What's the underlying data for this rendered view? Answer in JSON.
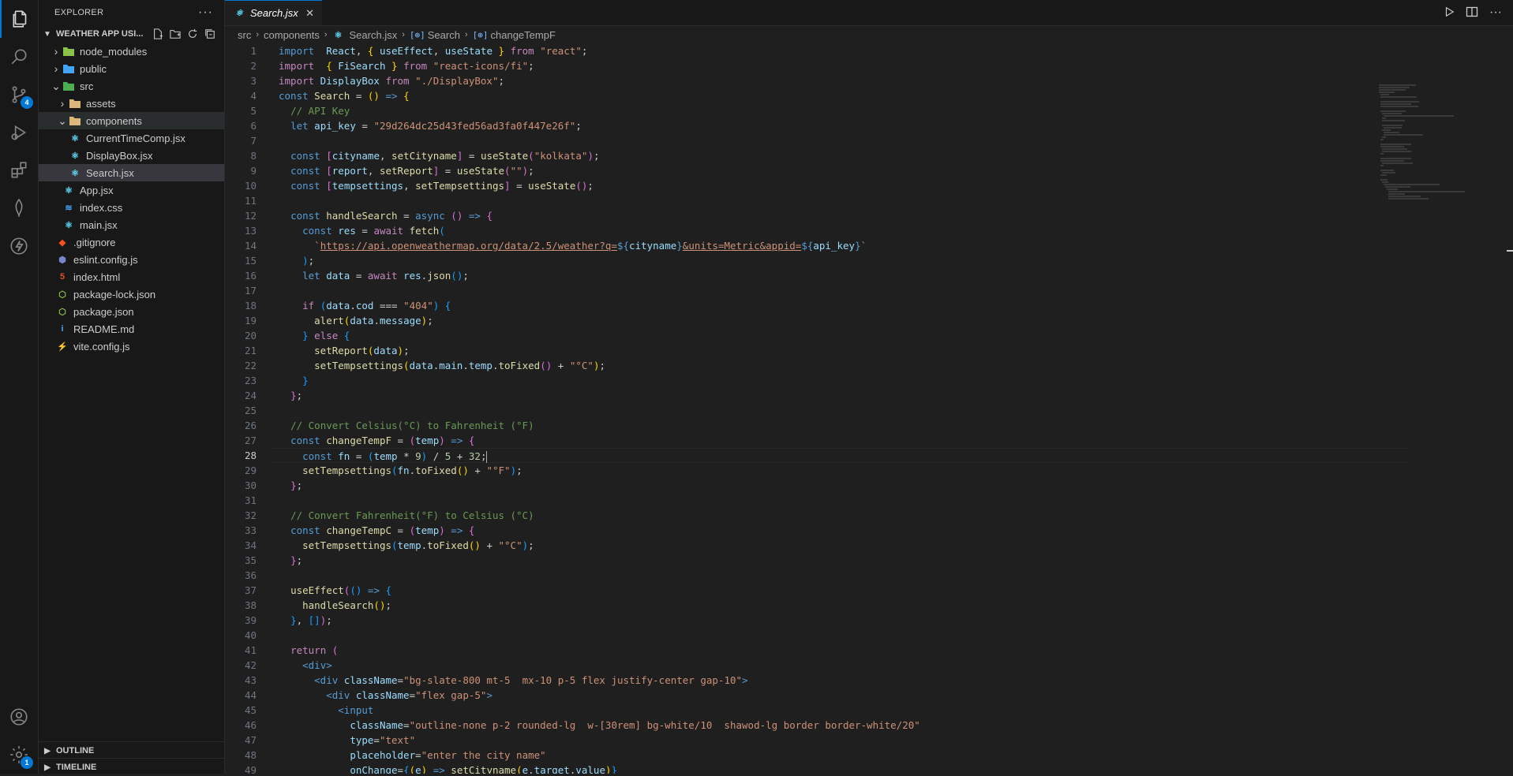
{
  "explorer": {
    "title": "EXPLORER",
    "more": "···",
    "folder": "WEATHER APP USI...",
    "items": [
      {
        "label": "node_modules",
        "indent": 1,
        "type": "folder",
        "open": false
      },
      {
        "label": "public",
        "indent": 1,
        "type": "folder",
        "open": false
      },
      {
        "label": "src",
        "indent": 1,
        "type": "folder",
        "open": true
      },
      {
        "label": "assets",
        "indent": 2,
        "type": "folder",
        "open": false
      },
      {
        "label": "components",
        "indent": 2,
        "type": "folder",
        "open": true
      },
      {
        "label": "CurrentTimeComp.jsx",
        "indent": 3,
        "type": "react"
      },
      {
        "label": "DisplayBox.jsx",
        "indent": 3,
        "type": "react"
      },
      {
        "label": "Search.jsx",
        "indent": 3,
        "type": "react"
      },
      {
        "label": "App.jsx",
        "indent": 2,
        "type": "react"
      },
      {
        "label": "index.css",
        "indent": 2,
        "type": "css"
      },
      {
        "label": "main.jsx",
        "indent": 2,
        "type": "react"
      },
      {
        "label": ".gitignore",
        "indent": 1,
        "type": "git"
      },
      {
        "label": "eslint.config.js",
        "indent": 1,
        "type": "eslint"
      },
      {
        "label": "index.html",
        "indent": 1,
        "type": "html"
      },
      {
        "label": "package-lock.json",
        "indent": 1,
        "type": "node"
      },
      {
        "label": "package.json",
        "indent": 1,
        "type": "node"
      },
      {
        "label": "README.md",
        "indent": 1,
        "type": "info"
      },
      {
        "label": "vite.config.js",
        "indent": 1,
        "type": "vite"
      }
    ],
    "outline": "OUTLINE",
    "timeline": "TIMELINE"
  },
  "activity": {
    "scm_badge": "4",
    "accounts_badge": "1"
  },
  "tab": {
    "label": "Search.jsx",
    "close": "✕"
  },
  "breadcrumb": {
    "parts": [
      "src",
      "components",
      "Search.jsx",
      "Search",
      "changeTempF"
    ],
    "sym_icon": "[⊕]"
  },
  "editor": {
    "current_line": 28,
    "lines": [
      [
        [
          "k",
          "import"
        ],
        [
          "",
          "  "
        ],
        [
          "v",
          "React"
        ],
        [
          "",
          ", "
        ],
        [
          "p1",
          "{"
        ],
        [
          "",
          ""
        ],
        [
          "v",
          " useEffect"
        ],
        [
          "",
          ", "
        ],
        [
          "v",
          "useState"
        ],
        [
          "",
          ""
        ],
        [
          "p1",
          " }"
        ],
        [
          "kc",
          " from"
        ],
        [
          "s",
          " \"react\""
        ],
        [
          "",
          ";"
        ]
      ],
      [
        [
          "kc",
          "import"
        ],
        [
          "",
          "  "
        ],
        [
          "p1",
          "{"
        ],
        [
          "v",
          " FiSearch"
        ],
        [
          "p1",
          " }"
        ],
        [
          "kc",
          " from"
        ],
        [
          "s",
          " \"react-icons/fi\""
        ],
        [
          "",
          ";"
        ]
      ],
      [
        [
          "kc",
          "import"
        ],
        [
          "v",
          " DisplayBox"
        ],
        [
          "kc",
          " from"
        ],
        [
          "s",
          " \"./DisplayBox\""
        ],
        [
          "",
          ";"
        ]
      ],
      [
        [
          "k",
          "const"
        ],
        [
          "f",
          " Search"
        ],
        [
          "",
          " = "
        ],
        [
          "p1",
          "()"
        ],
        [
          "k",
          " =>"
        ],
        [
          "p1",
          " {"
        ]
      ],
      [
        [
          "",
          "  "
        ],
        [
          "c",
          "// API Key"
        ]
      ],
      [
        [
          "",
          "  "
        ],
        [
          "k",
          "let"
        ],
        [
          "v",
          " api_key"
        ],
        [
          "",
          " = "
        ],
        [
          "s",
          "\"29d264dc25d43fed56ad3fa0f447e26f\""
        ],
        [
          "",
          ";"
        ]
      ],
      [
        [
          "",
          ""
        ]
      ],
      [
        [
          "",
          "  "
        ],
        [
          "k",
          "const"
        ],
        [
          "p2",
          " ["
        ],
        [
          "v",
          "cityname"
        ],
        [
          "",
          ", "
        ],
        [
          "f",
          "setCityname"
        ],
        [
          "p2",
          "]"
        ],
        [
          "",
          " = "
        ],
        [
          "f",
          "useState"
        ],
        [
          "p2",
          "("
        ],
        [
          "s",
          "\"kolkata\""
        ],
        [
          "p2",
          ")"
        ],
        [
          "",
          ";"
        ]
      ],
      [
        [
          "",
          "  "
        ],
        [
          "k",
          "const"
        ],
        [
          "p2",
          " ["
        ],
        [
          "v",
          "report"
        ],
        [
          "",
          ", "
        ],
        [
          "f",
          "setReport"
        ],
        [
          "p2",
          "]"
        ],
        [
          "",
          " = "
        ],
        [
          "f",
          "useState"
        ],
        [
          "p2",
          "("
        ],
        [
          "s",
          "\"\""
        ],
        [
          "p2",
          ")"
        ],
        [
          "",
          ";"
        ]
      ],
      [
        [
          "",
          "  "
        ],
        [
          "k",
          "const"
        ],
        [
          "p2",
          " ["
        ],
        [
          "v",
          "tempsettings"
        ],
        [
          "",
          ", "
        ],
        [
          "f",
          "setTempsettings"
        ],
        [
          "p2",
          "]"
        ],
        [
          "",
          " = "
        ],
        [
          "f",
          "useState"
        ],
        [
          "p2",
          "()"
        ],
        [
          "",
          ";"
        ]
      ],
      [
        [
          "",
          ""
        ]
      ],
      [
        [
          "",
          "  "
        ],
        [
          "k",
          "const"
        ],
        [
          "f",
          " handleSearch"
        ],
        [
          "",
          " = "
        ],
        [
          "k",
          "async"
        ],
        [
          "p2",
          " ()"
        ],
        [
          "k",
          " =>"
        ],
        [
          "p2",
          " {"
        ]
      ],
      [
        [
          "",
          "    "
        ],
        [
          "k",
          "const"
        ],
        [
          "v",
          " res"
        ],
        [
          "",
          " = "
        ],
        [
          "kc",
          "await"
        ],
        [
          "f",
          " fetch"
        ],
        [
          "p3",
          "("
        ]
      ],
      [
        [
          "",
          "      "
        ],
        [
          "s",
          "`"
        ],
        [
          "s u",
          "https://api.openweathermap.org/data/2.5/weather?q="
        ],
        [
          "k",
          "${"
        ],
        [
          "v",
          "cityname"
        ],
        [
          "k",
          "}"
        ],
        [
          "s u",
          "&units=Metric&appid="
        ],
        [
          "k",
          "${"
        ],
        [
          "v",
          "api_key"
        ],
        [
          "k",
          "}"
        ],
        [
          "s",
          "`"
        ]
      ],
      [
        [
          "",
          "    "
        ],
        [
          "p3",
          ")"
        ],
        [
          "",
          ";"
        ]
      ],
      [
        [
          "",
          "    "
        ],
        [
          "k",
          "let"
        ],
        [
          "v",
          " data"
        ],
        [
          "",
          " = "
        ],
        [
          "kc",
          "await"
        ],
        [
          "v",
          " res"
        ],
        [
          "",
          "."
        ],
        [
          "f",
          "json"
        ],
        [
          "p3",
          "()"
        ],
        [
          "",
          ";"
        ]
      ],
      [
        [
          "",
          ""
        ]
      ],
      [
        [
          "",
          "    "
        ],
        [
          "kc",
          "if"
        ],
        [
          "p3",
          " ("
        ],
        [
          "v",
          "data"
        ],
        [
          "",
          "."
        ],
        [
          "v",
          "cod"
        ],
        [
          "",
          " === "
        ],
        [
          "s",
          "\"404\""
        ],
        [
          "p3",
          ")"
        ],
        [
          "p3",
          " {"
        ]
      ],
      [
        [
          "",
          "      "
        ],
        [
          "f",
          "alert"
        ],
        [
          "p1",
          "("
        ],
        [
          "v",
          "data"
        ],
        [
          "",
          "."
        ],
        [
          "v",
          "message"
        ],
        [
          "p1",
          ")"
        ],
        [
          "",
          ";"
        ]
      ],
      [
        [
          "",
          "    "
        ],
        [
          "p3",
          "}"
        ],
        [
          "kc",
          " else"
        ],
        [
          "p3",
          " {"
        ]
      ],
      [
        [
          "",
          "      "
        ],
        [
          "f",
          "setReport"
        ],
        [
          "p1",
          "("
        ],
        [
          "v",
          "data"
        ],
        [
          "p1",
          ")"
        ],
        [
          "",
          ";"
        ]
      ],
      [
        [
          "",
          "      "
        ],
        [
          "f",
          "setTempsettings"
        ],
        [
          "p1",
          "("
        ],
        [
          "v",
          "data"
        ],
        [
          "",
          "."
        ],
        [
          "v",
          "main"
        ],
        [
          "",
          "."
        ],
        [
          "v",
          "temp"
        ],
        [
          "",
          "."
        ],
        [
          "f",
          "toFixed"
        ],
        [
          "p2",
          "()"
        ],
        [
          "",
          " + "
        ],
        [
          "s",
          "\"°C\""
        ],
        [
          "p1",
          ")"
        ],
        [
          "",
          ";"
        ]
      ],
      [
        [
          "",
          "    "
        ],
        [
          "p3",
          "}"
        ]
      ],
      [
        [
          "",
          "  "
        ],
        [
          "p2",
          "}"
        ],
        [
          "",
          ";"
        ]
      ],
      [
        [
          "",
          ""
        ]
      ],
      [
        [
          "",
          "  "
        ],
        [
          "c",
          "// Convert Celsius(°C) to Fahrenheit (°F)"
        ]
      ],
      [
        [
          "",
          "  "
        ],
        [
          "k",
          "const"
        ],
        [
          "f",
          " changeTempF"
        ],
        [
          "",
          " = "
        ],
        [
          "p2",
          "("
        ],
        [
          "v",
          "temp"
        ],
        [
          "p2",
          ")"
        ],
        [
          "k",
          " =>"
        ],
        [
          "p2",
          " {"
        ]
      ],
      [
        [
          "",
          "    "
        ],
        [
          "k",
          "const"
        ],
        [
          "v",
          " fn"
        ],
        [
          "",
          " = "
        ],
        [
          "p3",
          "("
        ],
        [
          "v",
          "temp"
        ],
        [
          "",
          " * "
        ],
        [
          "n",
          "9"
        ],
        [
          "p3",
          ")"
        ],
        [
          "",
          " / "
        ],
        [
          "n",
          "5"
        ],
        [
          "",
          " + "
        ],
        [
          "n",
          "32"
        ],
        [
          "",
          ";"
        ]
      ],
      [
        [
          "",
          "    "
        ],
        [
          "f",
          "setTempsettings"
        ],
        [
          "p3",
          "("
        ],
        [
          "v",
          "fn"
        ],
        [
          "",
          "."
        ],
        [
          "f",
          "toFixed"
        ],
        [
          "p1",
          "()"
        ],
        [
          "",
          " + "
        ],
        [
          "s",
          "\"°F\""
        ],
        [
          "p3",
          ")"
        ],
        [
          "",
          ";"
        ]
      ],
      [
        [
          "",
          "  "
        ],
        [
          "p2",
          "}"
        ],
        [
          "",
          ";"
        ]
      ],
      [
        [
          "",
          ""
        ]
      ],
      [
        [
          "",
          "  "
        ],
        [
          "c",
          "// Convert Fahrenheit(°F) to Celsius (°C)"
        ]
      ],
      [
        [
          "",
          "  "
        ],
        [
          "k",
          "const"
        ],
        [
          "f",
          " changeTempC"
        ],
        [
          "",
          " = "
        ],
        [
          "p2",
          "("
        ],
        [
          "v",
          "temp"
        ],
        [
          "p2",
          ")"
        ],
        [
          "k",
          " =>"
        ],
        [
          "p2",
          " {"
        ]
      ],
      [
        [
          "",
          "    "
        ],
        [
          "f",
          "setTempsettings"
        ],
        [
          "p3",
          "("
        ],
        [
          "v",
          "temp"
        ],
        [
          "",
          "."
        ],
        [
          "f",
          "toFixed"
        ],
        [
          "p1",
          "()"
        ],
        [
          "",
          " + "
        ],
        [
          "s",
          "\"°C\""
        ],
        [
          "p3",
          ")"
        ],
        [
          "",
          ";"
        ]
      ],
      [
        [
          "",
          "  "
        ],
        [
          "p2",
          "}"
        ],
        [
          "",
          ";"
        ]
      ],
      [
        [
          "",
          ""
        ]
      ],
      [
        [
          "",
          "  "
        ],
        [
          "f",
          "useEffect"
        ],
        [
          "p2",
          "("
        ],
        [
          "p3",
          "()"
        ],
        [
          "k",
          " =>"
        ],
        [
          "p3",
          " {"
        ]
      ],
      [
        [
          "",
          "    "
        ],
        [
          "f",
          "handleSearch"
        ],
        [
          "p1",
          "()"
        ],
        [
          "",
          ";"
        ]
      ],
      [
        [
          "",
          "  "
        ],
        [
          "p3",
          "}"
        ],
        [
          "",
          ", "
        ],
        [
          "p3",
          "[]"
        ],
        [
          "p2",
          ")"
        ],
        [
          "",
          ";"
        ]
      ],
      [
        [
          "",
          ""
        ]
      ],
      [
        [
          "",
          "  "
        ],
        [
          "kc",
          "return"
        ],
        [
          "p2",
          " ("
        ]
      ],
      [
        [
          "",
          "    "
        ],
        [
          "k",
          "<"
        ],
        [
          "k",
          "div"
        ],
        [
          "k",
          ">"
        ]
      ],
      [
        [
          "",
          "      "
        ],
        [
          "k",
          "<div"
        ],
        [
          "v",
          " className"
        ],
        [
          "",
          "="
        ],
        [
          "s",
          "\"bg-slate-800 mt-5  mx-10 p-5 flex justify-center gap-10\""
        ],
        [
          "k",
          ">"
        ]
      ],
      [
        [
          "",
          "        "
        ],
        [
          "k",
          "<div"
        ],
        [
          "v",
          " className"
        ],
        [
          "",
          "="
        ],
        [
          "s",
          "\"flex gap-5\""
        ],
        [
          "k",
          ">"
        ]
      ],
      [
        [
          "",
          "          "
        ],
        [
          "k",
          "<input"
        ]
      ],
      [
        [
          "",
          "            "
        ],
        [
          "v",
          "className"
        ],
        [
          "",
          "="
        ],
        [
          "s",
          "\"outline-none p-2 rounded-lg  w-[30rem] bg-white/10  shawod-lg border border-white/20\""
        ]
      ],
      [
        [
          "",
          "            "
        ],
        [
          "v",
          "type"
        ],
        [
          "",
          "="
        ],
        [
          "s",
          "\"text\""
        ]
      ],
      [
        [
          "",
          "            "
        ],
        [
          "v",
          "placeholder"
        ],
        [
          "",
          "="
        ],
        [
          "s",
          "\"enter the city name\""
        ]
      ],
      [
        [
          "",
          "            "
        ],
        [
          "v",
          "onChange"
        ],
        [
          "",
          "="
        ],
        [
          "p3",
          "{"
        ],
        [
          "p1",
          "("
        ],
        [
          "v",
          "e"
        ],
        [
          "p1",
          ")"
        ],
        [
          "k",
          " =>"
        ],
        [
          "f",
          " setCityname"
        ],
        [
          "p1",
          "("
        ],
        [
          "v",
          "e"
        ],
        [
          "",
          "."
        ],
        [
          "v",
          "target"
        ],
        [
          "",
          "."
        ],
        [
          "v",
          "value"
        ],
        [
          "p1",
          ")"
        ],
        [
          "p3",
          "}"
        ]
      ]
    ]
  }
}
